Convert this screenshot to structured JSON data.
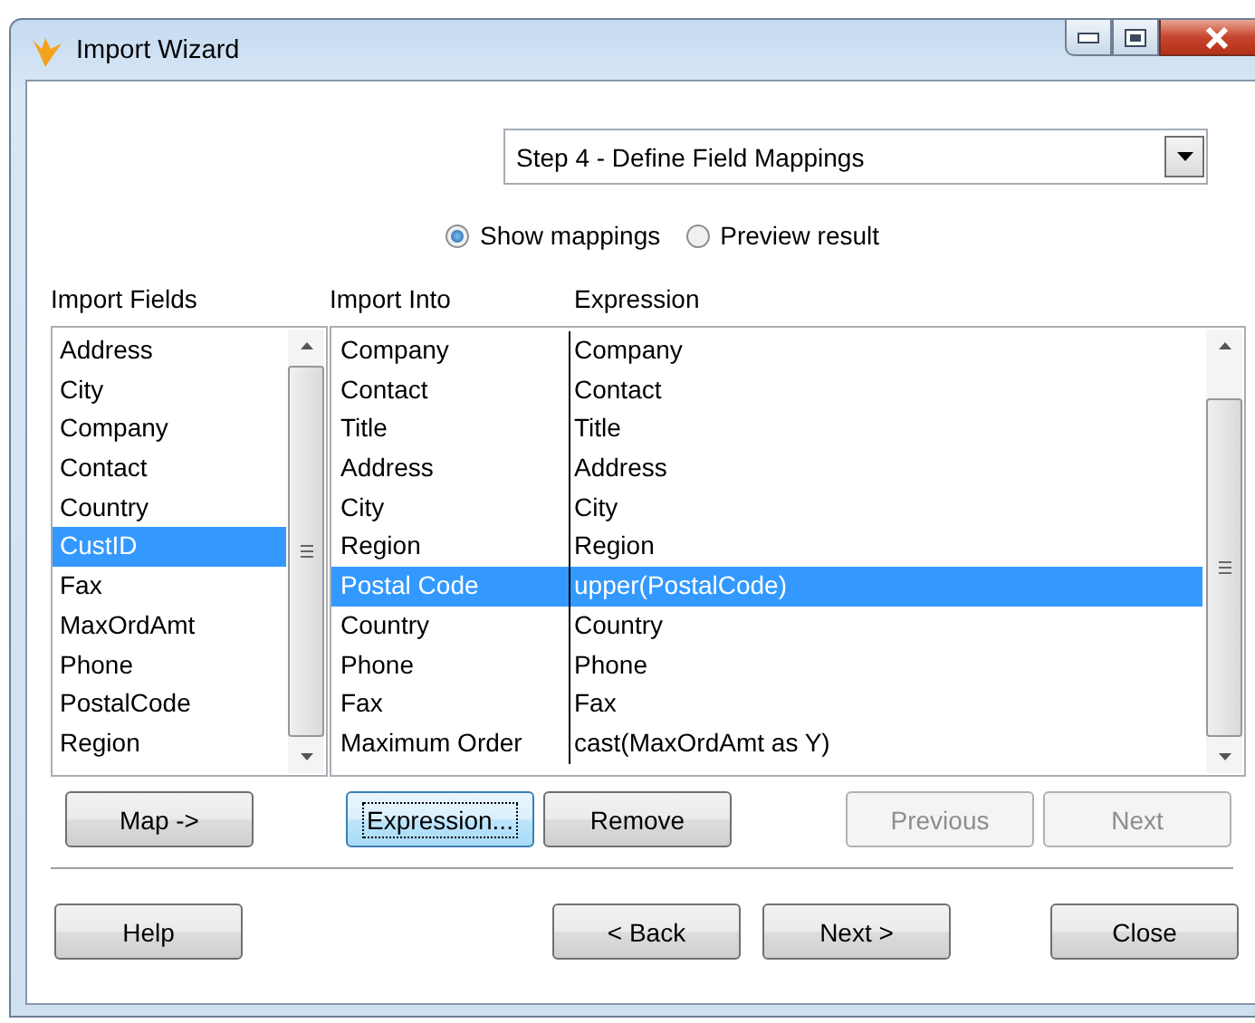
{
  "window": {
    "title": "Import Wizard"
  },
  "step_dropdown": {
    "value": "Step 4 - Define Field Mappings"
  },
  "view_options": [
    {
      "label": "Show mappings",
      "selected": true
    },
    {
      "label": "Preview result",
      "selected": false
    }
  ],
  "import_fields": {
    "heading": "Import Fields",
    "items": [
      {
        "label": "Address",
        "selected": false
      },
      {
        "label": "City",
        "selected": false
      },
      {
        "label": "Company",
        "selected": false
      },
      {
        "label": "Contact",
        "selected": false
      },
      {
        "label": "Country",
        "selected": false
      },
      {
        "label": "CustID",
        "selected": true
      },
      {
        "label": "Fax",
        "selected": false
      },
      {
        "label": "MaxOrdAmt",
        "selected": false
      },
      {
        "label": "Phone",
        "selected": false
      },
      {
        "label": "PostalCode",
        "selected": false
      },
      {
        "label": "Region",
        "selected": false
      }
    ]
  },
  "mappings": {
    "columns": [
      "Import Into",
      "Expression"
    ],
    "rows": [
      {
        "into": "Company",
        "expression": "Company",
        "selected": false
      },
      {
        "into": "Contact",
        "expression": "Contact",
        "selected": false
      },
      {
        "into": "Title",
        "expression": "Title",
        "selected": false
      },
      {
        "into": "Address",
        "expression": "Address",
        "selected": false
      },
      {
        "into": "City",
        "expression": "City",
        "selected": false
      },
      {
        "into": "Region",
        "expression": "Region",
        "selected": false
      },
      {
        "into": "Postal Code",
        "expression": "upper(PostalCode)",
        "selected": true
      },
      {
        "into": "Country",
        "expression": "Country",
        "selected": false
      },
      {
        "into": "Phone",
        "expression": "Phone",
        "selected": false
      },
      {
        "into": "Fax",
        "expression": "Fax",
        "selected": false
      },
      {
        "into": "Maximum Order",
        "expression": "cast(MaxOrdAmt as Y)",
        "selected": false
      }
    ]
  },
  "list_buttons": [
    {
      "label": "Map ->",
      "focused": false,
      "disabled": false
    },
    {
      "label": "Expression...",
      "focused": true,
      "disabled": false
    },
    {
      "label": "Remove",
      "focused": false,
      "disabled": false
    },
    {
      "label": "Previous",
      "focused": false,
      "disabled": true
    },
    {
      "label": "Next",
      "focused": false,
      "disabled": true
    }
  ],
  "dialog_buttons": [
    {
      "label": "Help",
      "focused": false,
      "disabled": false
    },
    {
      "label": "< Back",
      "focused": false,
      "disabled": false
    },
    {
      "label": "Next >",
      "focused": false,
      "disabled": false
    },
    {
      "label": "Close",
      "focused": false,
      "disabled": false
    }
  ]
}
